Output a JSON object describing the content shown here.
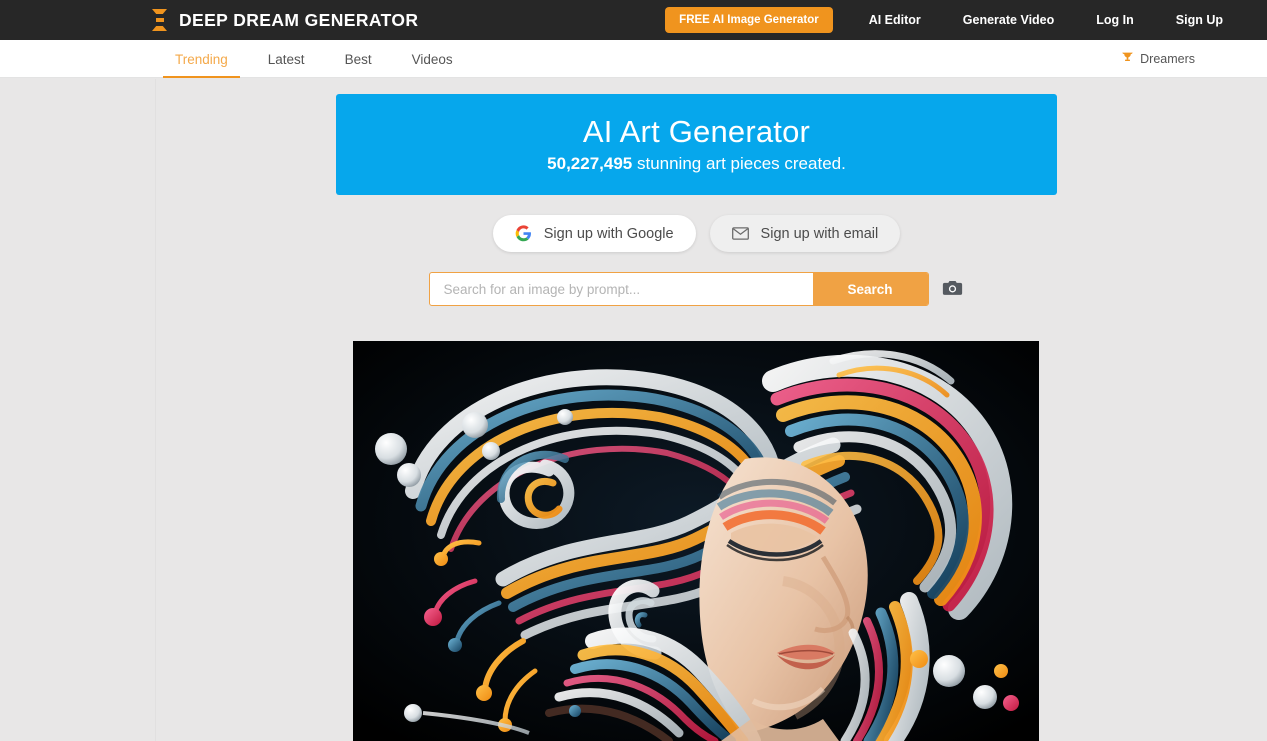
{
  "header": {
    "brand": "DEEP DREAM GENERATOR",
    "logo_icon": "hourglass-logo-icon",
    "cta_label": "FREE AI Image Generator",
    "links": [
      {
        "label": "AI Editor"
      },
      {
        "label": "Generate Video"
      },
      {
        "label": "Log In"
      },
      {
        "label": "Sign Up"
      }
    ],
    "colors": {
      "background": "#272727",
      "accent": "#f0941e",
      "text": "#ffffff"
    }
  },
  "subnav": {
    "tabs": [
      {
        "label": "Trending",
        "active": true
      },
      {
        "label": "Latest",
        "active": false
      },
      {
        "label": "Best",
        "active": false
      },
      {
        "label": "Videos",
        "active": false
      }
    ],
    "dreamers": {
      "label": "Dreamers",
      "icon": "trophy-icon"
    },
    "colors": {
      "background": "#ffffff",
      "active": "#f4a94a",
      "underline": "#f0941e"
    }
  },
  "hero": {
    "title": "AI Art Generator",
    "count": "50,227,495",
    "subtitle_rest": " stunning art pieces created.",
    "background": "#06a7ec"
  },
  "signup": {
    "google": {
      "label": "Sign up with Google",
      "icon": "google-g-icon"
    },
    "email": {
      "label": "Sign up with email",
      "icon": "envelope-icon"
    }
  },
  "search": {
    "placeholder": "Search for an image by prompt...",
    "value": "",
    "button_label": "Search",
    "camera_icon": "camera-icon",
    "accent": "#f0a244"
  },
  "artwork": {
    "alt": "Colorful swirling abstract portrait of a woman with flowing multicolored hair",
    "background": "#000000"
  },
  "page": {
    "background": "#e8e7e7"
  }
}
